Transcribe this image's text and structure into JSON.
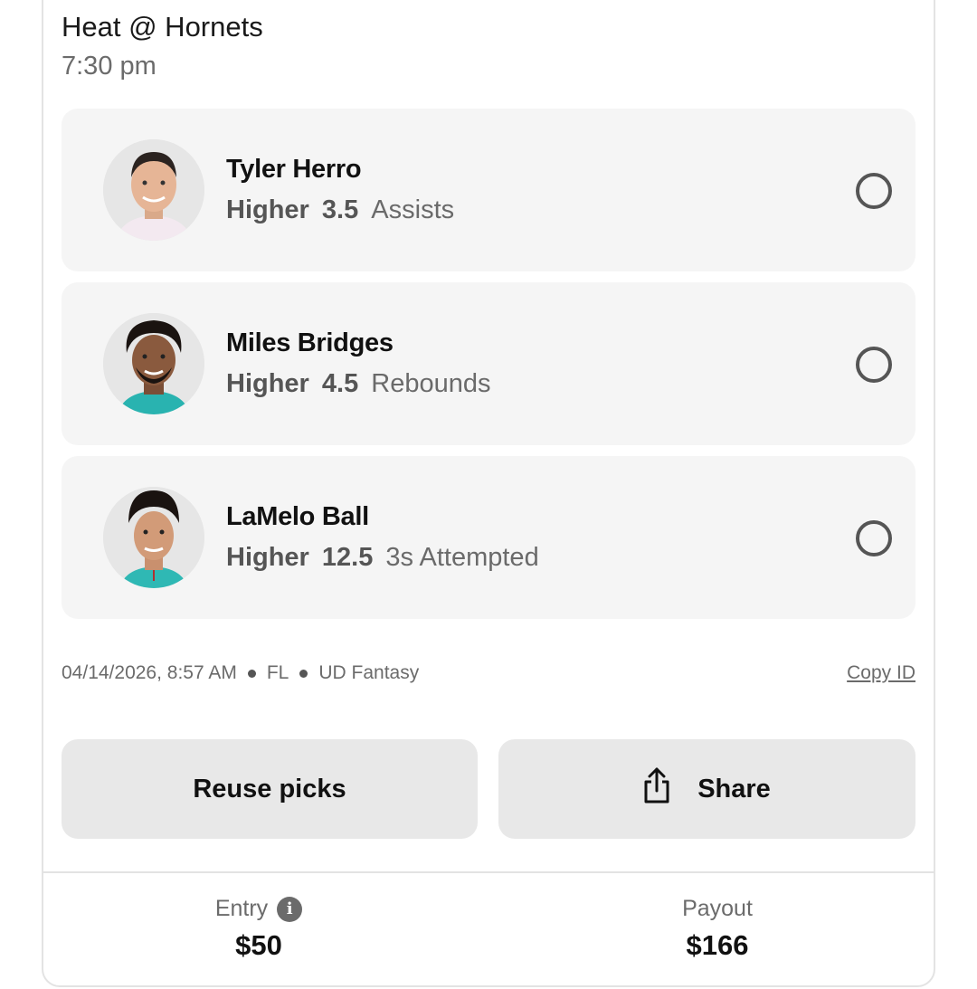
{
  "game": {
    "title": "Heat @ Hornets",
    "time": "7:30 pm"
  },
  "picks": [
    {
      "player": "Tyler Herro",
      "direction": "Higher",
      "line": "3.5",
      "stat": "Assists",
      "jersey_color": "#f3e9f0",
      "hair_color": "#2b2320"
    },
    {
      "player": "Miles Bridges",
      "direction": "Higher",
      "line": "4.5",
      "stat": "Rebounds",
      "jersey_color": "#29b3b0",
      "hair_color": "#1a1310"
    },
    {
      "player": "LaMelo Ball",
      "direction": "Higher",
      "line": "12.5",
      "stat": "3s Attempted",
      "jersey_color": "#2fb8b4",
      "hair_color": "#1a1310"
    }
  ],
  "meta": {
    "datetime": "04/14/2026, 8:57 AM",
    "state": "FL",
    "brand": "UD Fantasy",
    "copy_id_label": "Copy ID"
  },
  "actions": {
    "reuse_label": "Reuse picks",
    "share_label": "Share",
    "share_icon": "share-icon"
  },
  "footer": {
    "entry_label": "Entry",
    "entry_value": "$50",
    "payout_label": "Payout",
    "payout_value": "$166",
    "info_icon": "info-icon"
  }
}
